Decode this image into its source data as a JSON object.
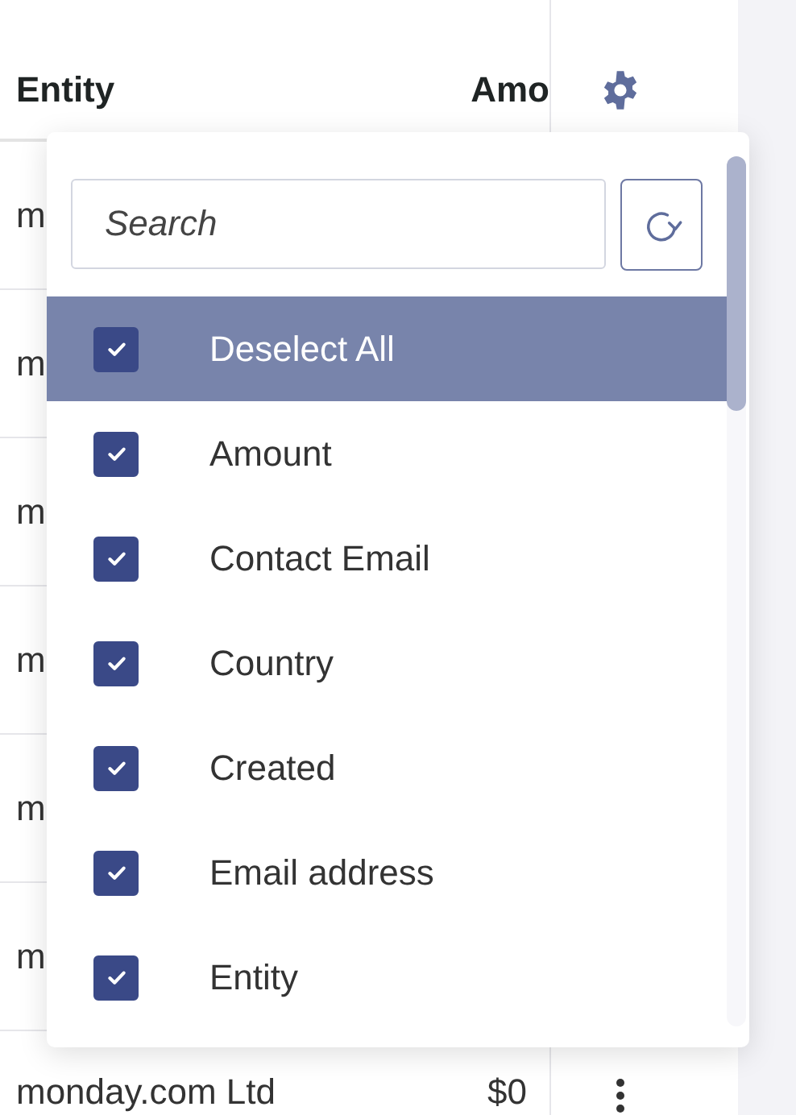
{
  "table": {
    "columns": [
      {
        "label": "Entity"
      },
      {
        "label": "Amo"
      }
    ],
    "rows": [
      {
        "entity": "m"
      },
      {
        "entity": "m"
      },
      {
        "entity": "m"
      },
      {
        "entity": "m"
      },
      {
        "entity": "m"
      },
      {
        "entity": "m"
      },
      {
        "entity": "monday.com Ltd",
        "amount": "$0"
      }
    ]
  },
  "column_picker": {
    "search": {
      "placeholder": "Search"
    },
    "options": [
      {
        "label": "Deselect All",
        "checked": true,
        "selected": true
      },
      {
        "label": "Amount",
        "checked": true,
        "selected": false
      },
      {
        "label": "Contact Email",
        "checked": true,
        "selected": false
      },
      {
        "label": "Country",
        "checked": true,
        "selected": false
      },
      {
        "label": "Created",
        "checked": true,
        "selected": false
      },
      {
        "label": "Email address",
        "checked": true,
        "selected": false
      },
      {
        "label": "Entity",
        "checked": true,
        "selected": false
      }
    ]
  }
}
